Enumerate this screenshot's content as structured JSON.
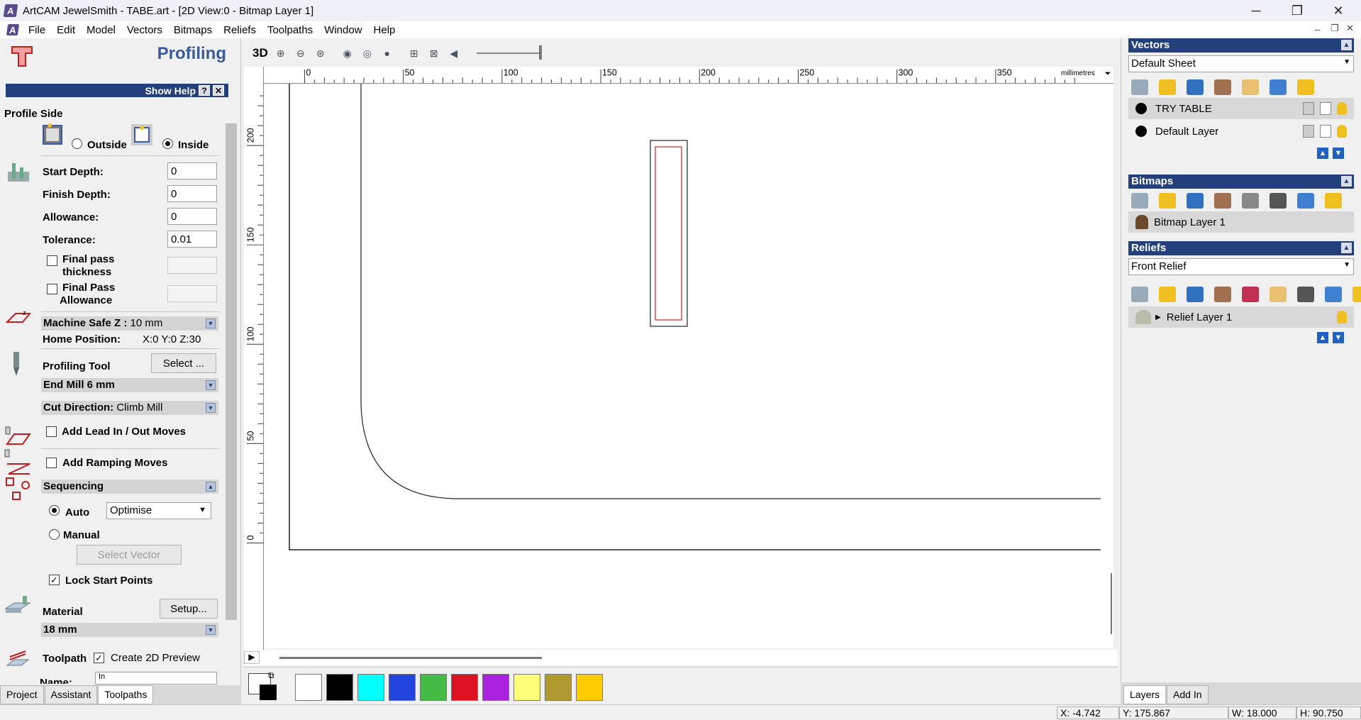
{
  "window": {
    "title": "ArtCAM JewelSmith - TABE.art - [2D View:0 - Bitmap Layer 1]",
    "minimize": "─",
    "restore": "❐",
    "close": "✕"
  },
  "menu": [
    "File",
    "Edit",
    "Model",
    "Vectors",
    "Bitmaps",
    "Reliefs",
    "Toolpaths",
    "Window",
    "Help"
  ],
  "left": {
    "title": "Profiling",
    "show_help": "Show Help",
    "help_q": "?",
    "help_x": "✕",
    "profile_side": "Profile Side",
    "outside": "Outside",
    "inside": "Inside",
    "start_depth_label": "Start Depth:",
    "start_depth": "0",
    "finish_depth_label": "Finish Depth:",
    "finish_depth": "0",
    "allowance_label": "Allowance:",
    "allowance": "0",
    "tolerance_label": "Tolerance:",
    "tolerance": "0.01",
    "final_pass_thickness_l1": "Final pass",
    "final_pass_thickness_l2": "thickness",
    "final_pass_allowance_l1": "Final Pass",
    "final_pass_allowance_l2": "Allowance",
    "machine_safe_label": "Machine Safe Z :",
    "machine_safe_value": "10 mm",
    "home_label": "Home Position:",
    "home_value": "X:0 Y:0 Z:30",
    "profiling_tool": "Profiling Tool",
    "select_btn": "Select ...",
    "tool_name": "End Mill 6 mm",
    "cut_dir_label": "Cut Direction:",
    "cut_dir_value": "Climb Mill",
    "lead_in": "Add Lead In / Out Moves",
    "ramping": "Add Ramping Moves",
    "sequencing": "Sequencing",
    "auto": "Auto",
    "optimise": "Optimise",
    "manual": "Manual",
    "select_vector": "Select Vector",
    "lock_start": "Lock Start Points",
    "material": "Material",
    "setup_btn": "Setup...",
    "material_value": "18 mm",
    "toolpath": "Toolpath",
    "create_preview": "Create 2D Preview",
    "name_label": "Name:",
    "name_value": "In",
    "tabs": [
      "Project",
      "Assistant",
      "Toolpaths"
    ]
  },
  "view": {
    "label_3d": "3D",
    "units": "millimetres",
    "xticks": [
      "0",
      "50",
      "100",
      "150",
      "200",
      "250",
      "300",
      "350"
    ],
    "yticks": [
      "200",
      "150",
      "100",
      "50",
      "0"
    ]
  },
  "palette": {
    "colors": [
      "#ffffff",
      "#000000",
      "#00ffff",
      "#2244dd",
      "#44bb44",
      "#dd1122",
      "#aa22dd",
      "#ffff77",
      "#b09a30",
      "#ffcc00"
    ]
  },
  "right": {
    "vectors": "Vectors",
    "vectors_sheet": "Default Sheet",
    "vector_layers": [
      "TRY TABLE",
      "Default Layer"
    ],
    "bitmaps": "Bitmaps",
    "bitmap_layer": "Bitmap Layer 1",
    "reliefs": "Reliefs",
    "relief_sel": "Front Relief",
    "relief_layer": "Relief Layer 1",
    "tabs": [
      "Layers",
      "Add In"
    ]
  },
  "status": {
    "x": "X: -4.742",
    "y": "Y: 175.867",
    "w": "W: 18.000",
    "h": "H: 90.750"
  }
}
